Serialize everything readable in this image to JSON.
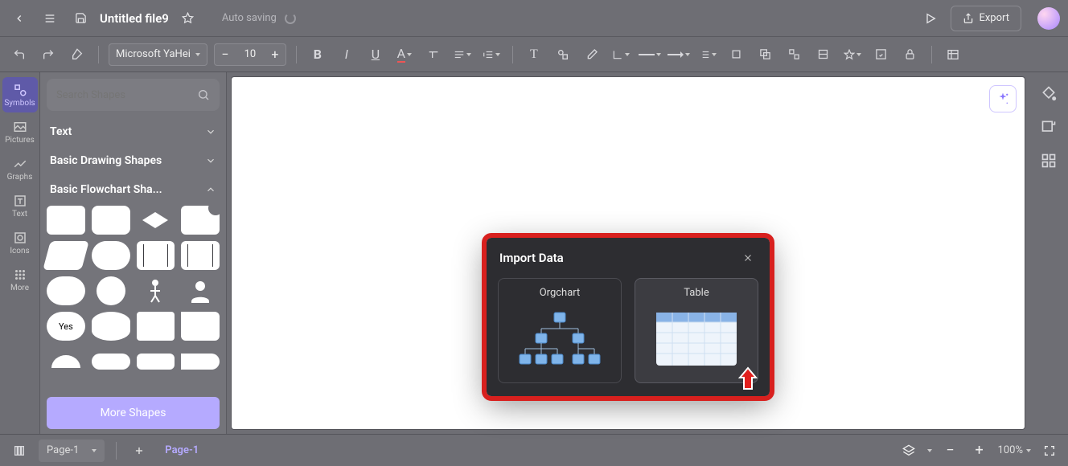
{
  "header": {
    "title": "Untitled file9",
    "autosave": "Auto saving",
    "export": "Export"
  },
  "toolbar": {
    "font": "Microsoft YaHei",
    "size": "10"
  },
  "rail": {
    "items": [
      "Symbols",
      "Pictures",
      "Graphs",
      "Text",
      "Icons",
      "More"
    ]
  },
  "panel": {
    "search_placeholder": "Search Shapes",
    "cat_text": "Text",
    "cat_basic": "Basic Drawing Shapes",
    "cat_flow": "Basic Flowchart Sha...",
    "yes_label": "Yes",
    "more": "More Shapes"
  },
  "dialog": {
    "title": "Import Data",
    "opt1": "Orgchart",
    "opt2": "Table"
  },
  "status": {
    "page_sel": "Page-1",
    "page_tab": "Page-1",
    "zoom": "100%"
  }
}
